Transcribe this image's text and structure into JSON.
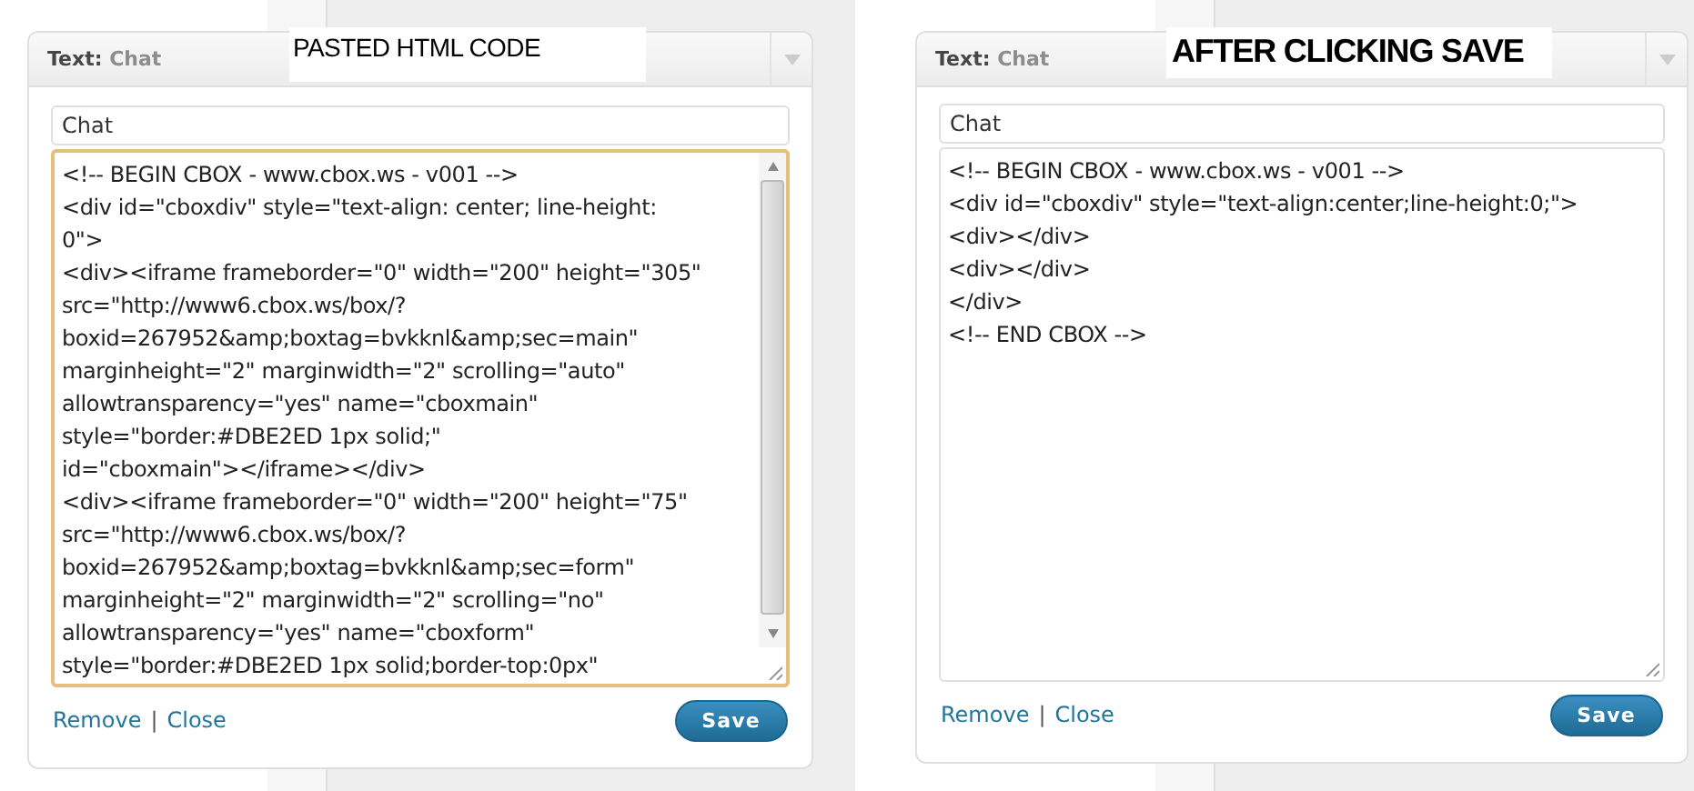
{
  "panels": [
    {
      "header": {
        "label": "Text:",
        "title": "Chat"
      },
      "caption": {
        "text": "PASTED HTML CODE",
        "kind": "plain"
      },
      "title_field": {
        "value": "Chat"
      },
      "content_field": {
        "focused": true,
        "has_scrollbar": true,
        "lines": [
          "<!-- BEGIN CBOX - www.cbox.ws - v001 -->",
          "<div id=\"cboxdiv\" style=\"text-align: center; line-height:",
          "0\">",
          "<div><iframe frameborder=\"0\" width=\"200\" height=\"305\"",
          "src=\"http://www6.cbox.ws/box/?",
          "boxid=267952&amp;boxtag=bvkknl&amp;sec=main\"",
          "marginheight=\"2\" marginwidth=\"2\" scrolling=\"auto\"",
          "allowtransparency=\"yes\" name=\"cboxmain\"",
          "style=\"border:#DBE2ED 1px solid;\"",
          "id=\"cboxmain\"></iframe></div>",
          "<div><iframe frameborder=\"0\" width=\"200\" height=\"75\"",
          "src=\"http://www6.cbox.ws/box/?",
          "boxid=267952&amp;boxtag=bvkknl&amp;sec=form\"",
          "marginheight=\"2\" marginwidth=\"2\" scrolling=\"no\"",
          "allowtransparency=\"yes\" name=\"cboxform\"",
          "style=\"border:#DBE2ED 1px solid;border-top:0px\""
        ]
      },
      "links": [
        "Remove",
        "Close"
      ],
      "separator": "|",
      "save": "Save"
    },
    {
      "header": {
        "label": "Text:",
        "title": "Chat"
      },
      "caption": {
        "text": "AFTER CLICKING SAVE",
        "kind": "bold"
      },
      "title_field": {
        "value": "Chat"
      },
      "content_field": {
        "focused": false,
        "has_scrollbar": false,
        "lines": [
          "<!-- BEGIN CBOX - www.cbox.ws - v001 -->",
          "<div id=\"cboxdiv\" style=\"text-align:center;line-height:0;\">",
          "<div></div>",
          "<div></div>",
          "</div>",
          "<!-- END CBOX -->"
        ]
      },
      "links": [
        "Remove",
        "Close"
      ],
      "separator": "|",
      "save": "Save"
    }
  ]
}
